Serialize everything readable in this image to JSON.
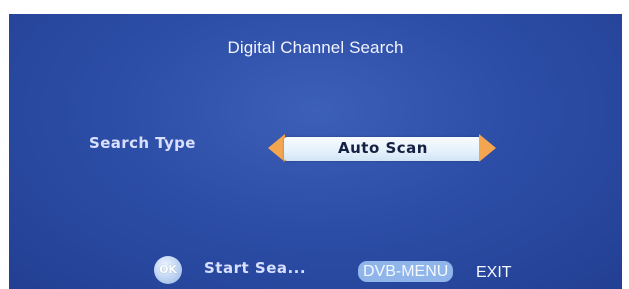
{
  "screen": {
    "title": "Digital Channel Search"
  },
  "search": {
    "label": "Search Type",
    "value": "Auto Scan"
  },
  "footer": {
    "ok_icon_text": "OK",
    "start_label": "Start Sea...",
    "menu_key": "DVB-MENU",
    "exit_label": "EXIT"
  },
  "colors": {
    "background": "#2d4ea7",
    "arrow": "#f3a64f",
    "selector_box": "#e5f1fb",
    "menu_key_bg": "#8fb5ea"
  }
}
